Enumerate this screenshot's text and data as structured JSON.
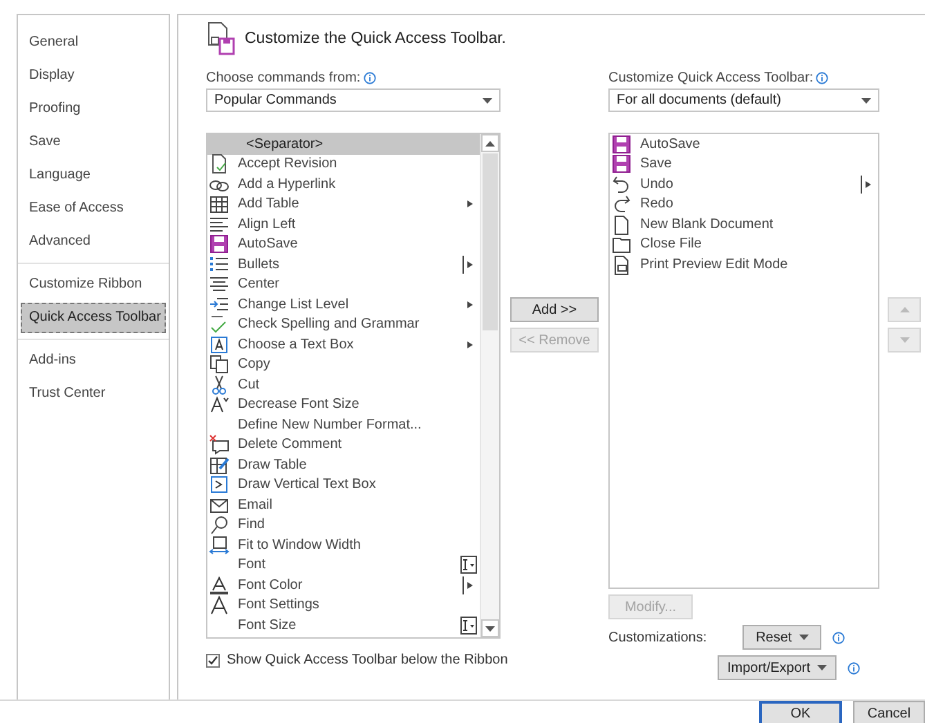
{
  "sidebar": {
    "groups": [
      [
        {
          "label": "General",
          "selected": false
        },
        {
          "label": "Display",
          "selected": false
        },
        {
          "label": "Proofing",
          "selected": false
        },
        {
          "label": "Save",
          "selected": false
        },
        {
          "label": "Language",
          "selected": false
        },
        {
          "label": "Ease of Access",
          "selected": false
        },
        {
          "label": "Advanced",
          "selected": false
        }
      ],
      [
        {
          "label": "Customize Ribbon",
          "selected": false
        },
        {
          "label": "Quick Access Toolbar",
          "selected": true
        }
      ],
      [
        {
          "label": "Add-ins",
          "selected": false
        },
        {
          "label": "Trust Center",
          "selected": false
        }
      ]
    ]
  },
  "heading": "Customize the Quick Access Toolbar.",
  "commands_label": "Choose commands from:",
  "commands_dropdown": {
    "value": "Popular Commands"
  },
  "toolbar_label": "Customize Quick Access Toolbar:",
  "toolbar_dropdown": {
    "value": "For all documents (default)"
  },
  "commands": [
    {
      "label": "<Separator>",
      "selected": true,
      "kind": "plain"
    },
    {
      "label": "Accept Revision",
      "selected": false,
      "kind": "plain"
    },
    {
      "label": "Add a Hyperlink",
      "selected": false,
      "kind": "plain"
    },
    {
      "label": "Add Table",
      "selected": false,
      "kind": "submenu"
    },
    {
      "label": "Align Left",
      "selected": false,
      "kind": "plain"
    },
    {
      "label": "AutoSave",
      "selected": false,
      "kind": "plain"
    },
    {
      "label": "Bullets",
      "selected": false,
      "kind": "split"
    },
    {
      "label": "Center",
      "selected": false,
      "kind": "plain"
    },
    {
      "label": "Change List Level",
      "selected": false,
      "kind": "submenu"
    },
    {
      "label": "Check Spelling and Grammar",
      "selected": false,
      "kind": "plain"
    },
    {
      "label": "Choose a Text Box",
      "selected": false,
      "kind": "submenu"
    },
    {
      "label": "Copy",
      "selected": false,
      "kind": "plain"
    },
    {
      "label": "Cut",
      "selected": false,
      "kind": "plain"
    },
    {
      "label": "Decrease Font Size",
      "selected": false,
      "kind": "plain"
    },
    {
      "label": "Define New Number Format...",
      "selected": false,
      "kind": "plain"
    },
    {
      "label": "Delete Comment",
      "selected": false,
      "kind": "plain"
    },
    {
      "label": "Draw Table",
      "selected": false,
      "kind": "plain"
    },
    {
      "label": "Draw Vertical Text Box",
      "selected": false,
      "kind": "plain"
    },
    {
      "label": "Email",
      "selected": false,
      "kind": "plain"
    },
    {
      "label": "Find",
      "selected": false,
      "kind": "plain"
    },
    {
      "label": "Fit to Window Width",
      "selected": false,
      "kind": "plain"
    },
    {
      "label": "Font",
      "selected": false,
      "kind": "field"
    },
    {
      "label": "Font Color",
      "selected": false,
      "kind": "split"
    },
    {
      "label": "Font Settings",
      "selected": false,
      "kind": "plain"
    },
    {
      "label": "Font Size",
      "selected": false,
      "kind": "field"
    }
  ],
  "toolbar_items": [
    {
      "label": "AutoSave",
      "selected": false,
      "kind": "plain"
    },
    {
      "label": "Save",
      "selected": false,
      "kind": "plain"
    },
    {
      "label": "Undo",
      "selected": false,
      "kind": "split"
    },
    {
      "label": "Redo",
      "selected": false,
      "kind": "plain"
    },
    {
      "label": "New Blank Document",
      "selected": false,
      "kind": "plain"
    },
    {
      "label": "Close File",
      "selected": false,
      "kind": "plain"
    },
    {
      "label": "Print Preview Edit Mode",
      "selected": false,
      "kind": "plain"
    }
  ],
  "add_button": {
    "label": "Add >>",
    "disabled": false
  },
  "remove_button": {
    "label": "<< Remove",
    "disabled": true
  },
  "move_up_button": {
    "disabled": true
  },
  "move_down_button": {
    "disabled": true
  },
  "modify_button": {
    "label": "Modify...",
    "disabled": true
  },
  "customizations_label": "Customizations:",
  "reset_button": {
    "label": "Reset"
  },
  "import_export_button": {
    "label": "Import/Export"
  },
  "show_below_checkbox": {
    "label": "Show Quick Access Toolbar below the Ribbon",
    "checked": true
  },
  "footer_buttons": [
    {
      "label": "OK",
      "default": true
    },
    {
      "label": "Cancel",
      "default": false
    }
  ]
}
